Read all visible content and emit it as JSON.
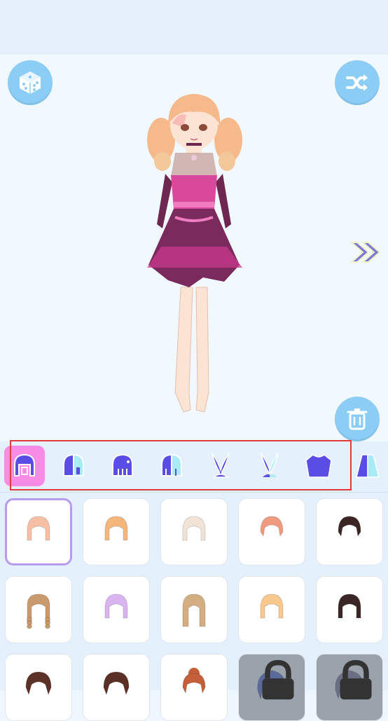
{
  "colors": {
    "accent_blue": "#8ccdf6",
    "category_selected": "#f78ce6",
    "category_icon": "#5a4de6",
    "item_selected_border": "#b79af2",
    "highlight_box": "#e23b3b"
  },
  "toolbar": {
    "random_icon": "dice-icon",
    "shuffle_icon": "shuffle-icon",
    "delete_icon": "trash-icon",
    "next_icon": "double-chevron-right-icon"
  },
  "categories": [
    {
      "icon": "hair-front-icon",
      "selected": true
    },
    {
      "icon": "hair-half-icon",
      "selected": false
    },
    {
      "icon": "hair-back-icon",
      "selected": false
    },
    {
      "icon": "hair-back-half-icon",
      "selected": false
    },
    {
      "icon": "bunny-ears-icon",
      "selected": false
    },
    {
      "icon": "bunny-ears-half-icon",
      "selected": false
    },
    {
      "icon": "top-shirt-icon",
      "selected": false
    },
    {
      "icon": "outfit-partial-icon",
      "selected": false
    }
  ],
  "hair_items": [
    {
      "color": "#f7c0a6",
      "style": "bob-bangs",
      "selected": true,
      "locked": false
    },
    {
      "color": "#f6b77c",
      "style": "shaggy",
      "selected": false,
      "locked": false
    },
    {
      "color": "#f1e3d6",
      "style": "bob-bangs",
      "selected": false,
      "locked": false
    },
    {
      "color": "#f09a80",
      "style": "short",
      "selected": false,
      "locked": false
    },
    {
      "color": "#3b2623",
      "style": "short",
      "selected": false,
      "locked": false
    },
    {
      "color": "#c99a6e",
      "style": "braids",
      "selected": false,
      "locked": false
    },
    {
      "color": "#d9b4ee",
      "style": "bob",
      "selected": false,
      "locked": false
    },
    {
      "color": "#d3ae80",
      "style": "long-straight",
      "selected": false,
      "locked": false
    },
    {
      "color": "#f8c88d",
      "style": "bob",
      "selected": false,
      "locked": false
    },
    {
      "color": "#3a2626",
      "style": "bob",
      "selected": false,
      "locked": false
    },
    {
      "color": "#5b3128",
      "style": "pixie",
      "selected": false,
      "locked": false
    },
    {
      "color": "#5a3026",
      "style": "pixie",
      "selected": false,
      "locked": false
    },
    {
      "color": "#c55f3a",
      "style": "bun",
      "selected": false,
      "locked": false
    },
    {
      "color": "#5a6a9a",
      "style": "messy",
      "selected": false,
      "locked": true
    },
    {
      "color": "#6a6f86",
      "style": "messy",
      "selected": false,
      "locked": true
    }
  ]
}
